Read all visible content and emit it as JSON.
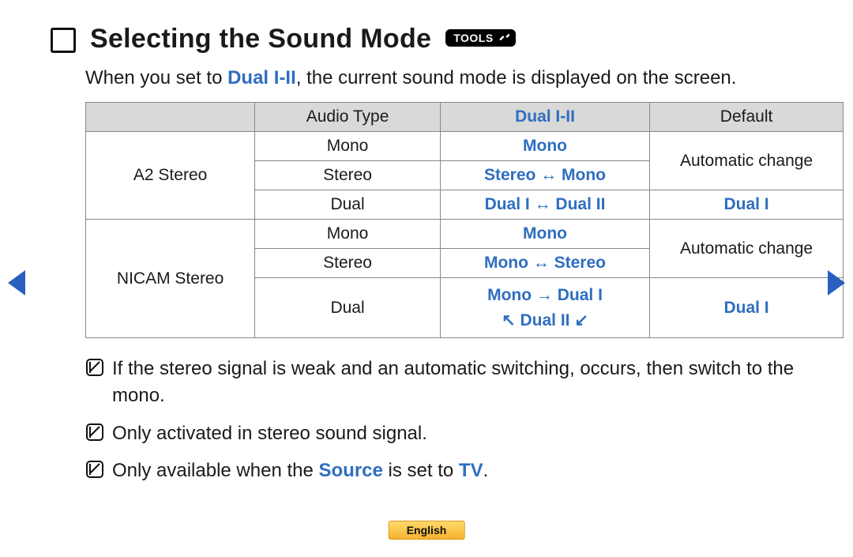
{
  "heading": {
    "title": "Selecting the Sound Mode",
    "badge": "TOOLS"
  },
  "intro": {
    "before": "When you set to ",
    "highlight": "Dual I-II",
    "after": ", the current sound mode is displayed on the screen."
  },
  "table": {
    "headers": {
      "blank": "",
      "audio_type": "Audio Type",
      "dual": "Dual I-II",
      "default": "Default"
    },
    "a2": {
      "label": "A2 Stereo",
      "r1": {
        "audio": "Mono",
        "dual": "Mono",
        "def": "Automatic change"
      },
      "r2": {
        "audio": "Stereo",
        "dual": "Stereo ↔ Mono"
      },
      "r3": {
        "audio": "Dual",
        "dual": "Dual I ↔ Dual II",
        "def": "Dual I"
      }
    },
    "nicam": {
      "label": "NICAM Stereo",
      "r1": {
        "audio": "Mono",
        "dual": "Mono",
        "def": "Automatic change"
      },
      "r2": {
        "audio": "Stereo",
        "dual": "Mono ↔ Stereo"
      },
      "r3": {
        "audio": "Dual",
        "dual_line1": "Mono → Dual I",
        "dual_line2": "↖ Dual II ↙",
        "def": "Dual I"
      }
    }
  },
  "notes": {
    "n1": "If the stereo signal is weak and an automatic switching, occurs, then switch to the mono.",
    "n2": "Only activated in stereo sound signal.",
    "n3_a": "Only available when the ",
    "n3_src": "Source",
    "n3_b": " is set to ",
    "n3_tv": "TV",
    "n3_c": "."
  },
  "footer": {
    "lang": "English"
  }
}
